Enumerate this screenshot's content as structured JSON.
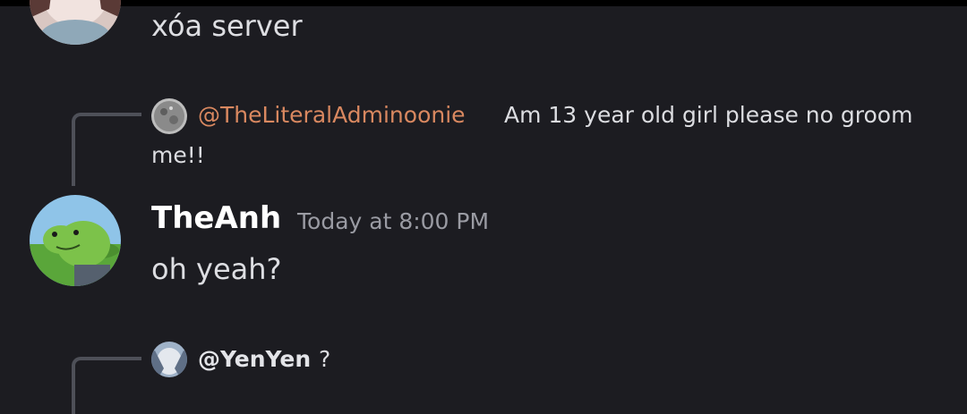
{
  "messages": [
    {
      "text": "xóa server"
    },
    {
      "reply": {
        "mention": "@TheLiteralAdminoonie",
        "text_line1": "Am 13 year old girl please no groom",
        "text_line2": "me!!"
      },
      "username": "TheAnh",
      "timestamp": "Today at 8:00 PM",
      "text": "oh yeah?"
    },
    {
      "reply": {
        "mention": "@YenYen",
        "text": "?"
      }
    }
  ],
  "colors": {
    "background": "#1c1c21",
    "mention": "#d98860",
    "timestamp": "#9a9ba3",
    "reply_line": "#4e5058"
  }
}
